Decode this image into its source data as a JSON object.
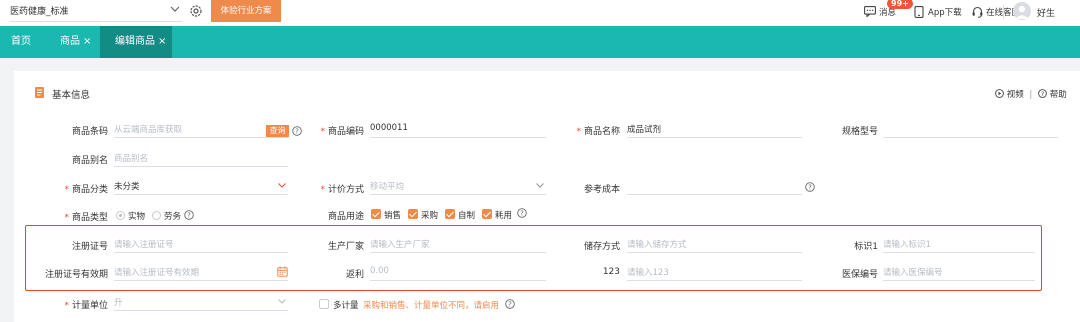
{
  "topbar": {
    "industry": "医药健康_标准",
    "trial_button": "体验行业方案",
    "messages": "消息",
    "message_badge": "99+",
    "app_download": "App下载",
    "online_service": "在线客服",
    "greeting": "好生"
  },
  "tabs": [
    {
      "label": "首页",
      "closable": false,
      "active": false
    },
    {
      "label": "商品",
      "closable": true,
      "active": false
    },
    {
      "label": "编辑商品",
      "closable": true,
      "active": true
    }
  ],
  "tab_close": "×",
  "section": {
    "title": "基本信息",
    "video": "视频",
    "help": "帮助",
    "separator": "|"
  },
  "form": {
    "barcode": {
      "label": "商品条码",
      "placeholder": "从云端商品库获取",
      "button": "查询"
    },
    "code": {
      "label": "商品编码",
      "value": "0000011"
    },
    "name": {
      "label": "商品名称",
      "value": "成品试剂"
    },
    "spec": {
      "label": "规格型号"
    },
    "alias": {
      "label": "商品别名",
      "placeholder": "商品别名"
    },
    "category": {
      "label": "商品分类",
      "value": "未分类"
    },
    "pricing": {
      "label": "计价方式",
      "placeholder": "移动平均"
    },
    "ref_cost": {
      "label": "参考成本"
    },
    "type": {
      "label": "商品类型",
      "options": [
        "实物",
        "劳务"
      ]
    },
    "usage": {
      "label": "商品用途",
      "options": [
        "销售",
        "采购",
        "自制",
        "耗用"
      ]
    },
    "reg_no": {
      "label": "注册证号",
      "placeholder": "请输入注册证号"
    },
    "manufacturer": {
      "label": "生产厂家",
      "placeholder": "请输入生产厂家"
    },
    "storage": {
      "label": "储存方式",
      "placeholder": "请输入储存方式"
    },
    "tag1": {
      "label": "标识1",
      "placeholder": "请输入标识1"
    },
    "reg_expiry": {
      "label": "注册证号有效期",
      "placeholder": "请输入注册证号有效期"
    },
    "rebate": {
      "label": "返利",
      "placeholder": "0.00"
    },
    "field_123": {
      "label": "123",
      "placeholder": "请输入123"
    },
    "insurance_no": {
      "label": "医保编号",
      "placeholder": "请输入医保编号"
    },
    "unit": {
      "label": "计量单位",
      "value": "升"
    },
    "multi_unit": {
      "label": "多计量",
      "hint": "采购和销售、计量单位不同，请启用"
    }
  },
  "colors": {
    "teal": "#1ab8ae",
    "teal_active": "#138c86",
    "orange": "#f08a4b",
    "required_red": "#e64a36",
    "highlight_red": "#e8452f"
  },
  "icons": [
    "chevron-down-icon",
    "gear-icon",
    "message-icon",
    "phone-icon",
    "headset-icon",
    "avatar-icon",
    "document-icon",
    "play-circle-icon",
    "help-circle-icon",
    "calendar-icon",
    "question-icon"
  ]
}
